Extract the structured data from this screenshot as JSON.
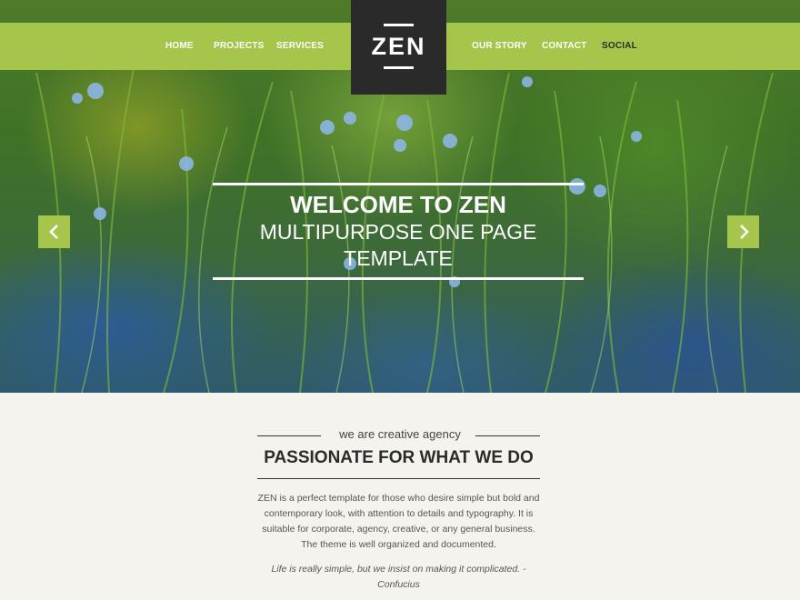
{
  "nav": {
    "left": [
      "HOME",
      "PROJECTS",
      "SERVICES"
    ],
    "right": [
      "OUR STORY",
      "CONTACT",
      "SOCIAL"
    ]
  },
  "logo": {
    "text": "ZEN"
  },
  "hero": {
    "title": "WELCOME TO ZEN",
    "subtitle": "MULTIPURPOSE ONE PAGE TEMPLATE",
    "prev_icon": "chevron-left-icon",
    "next_icon": "chevron-right-icon"
  },
  "about": {
    "tagline": "we are creative agency",
    "headline": "PASSIONATE FOR WHAT WE DO",
    "body": "ZEN is a perfect template for those who desire simple but bold and contemporary look, with attention to details and typography. It is suitable for corporate, agency, creative, or any general business. The theme is well organized and documented.",
    "quote": "Life is really simple, but we insist on making it complicated. - Confucius"
  },
  "colors": {
    "accent": "#a5c64b",
    "logo_bg": "#2b2a2a",
    "page_bg": "#f4f3ee"
  }
}
